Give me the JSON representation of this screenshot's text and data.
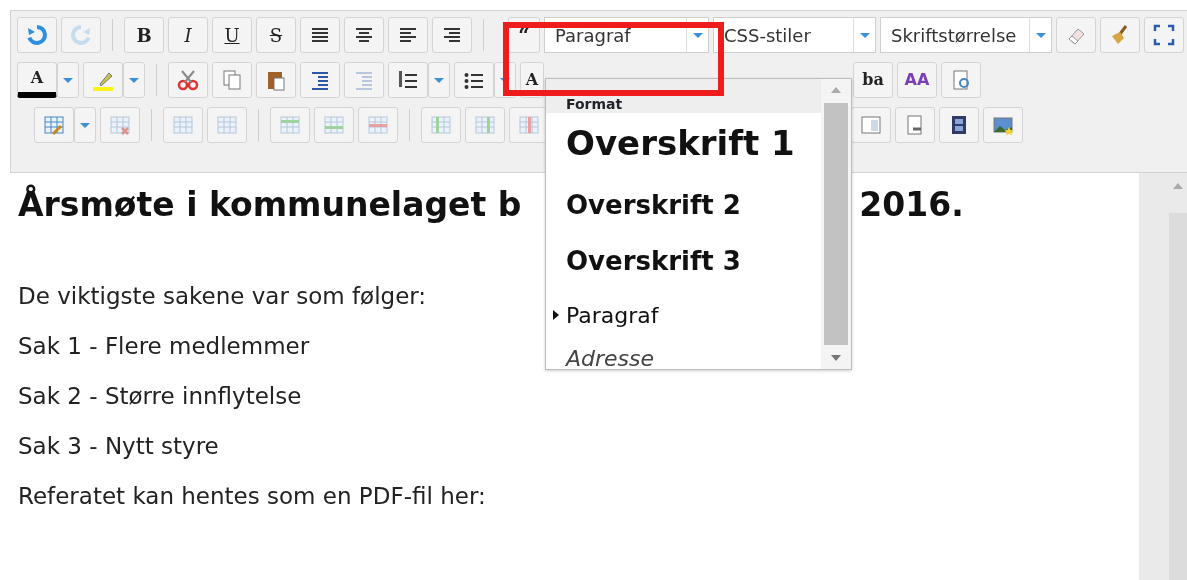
{
  "toolbar": {
    "bold": "B",
    "italic": "I",
    "underline": "U",
    "strikethrough": "S",
    "blockquote": "“",
    "text_color": "A",
    "styles": "A",
    "subscript": "ba",
    "font_size": "AA"
  },
  "combos": [
    {
      "value": "Paragraf"
    },
    {
      "value": "CSS-stiler"
    },
    {
      "value": "Skriftstørrelse"
    }
  ],
  "format_menu": {
    "title": "Format",
    "items": [
      {
        "label": "Overskrift 1",
        "kind": "h1",
        "selected": false
      },
      {
        "label": "Overskrift 2",
        "kind": "h2",
        "selected": false
      },
      {
        "label": "Overskrift 3",
        "kind": "h3",
        "selected": false
      },
      {
        "label": "Paragraf",
        "kind": "p",
        "selected": true
      },
      {
        "label": "Adresse",
        "kind": "address",
        "selected": false
      }
    ]
  },
  "editor": {
    "heading_parts": [
      "Årsmøte i kommunelaget b",
      "2016."
    ],
    "paragraphs": [
      "De viktigste sakene var som følger:",
      "Sak 1 - Flere medlemmer",
      "Sak 2 - Større innflytelse",
      "Sak 3 - Nytt styre",
      "Referatet kan hentes som en PDF-fil her:"
    ]
  }
}
